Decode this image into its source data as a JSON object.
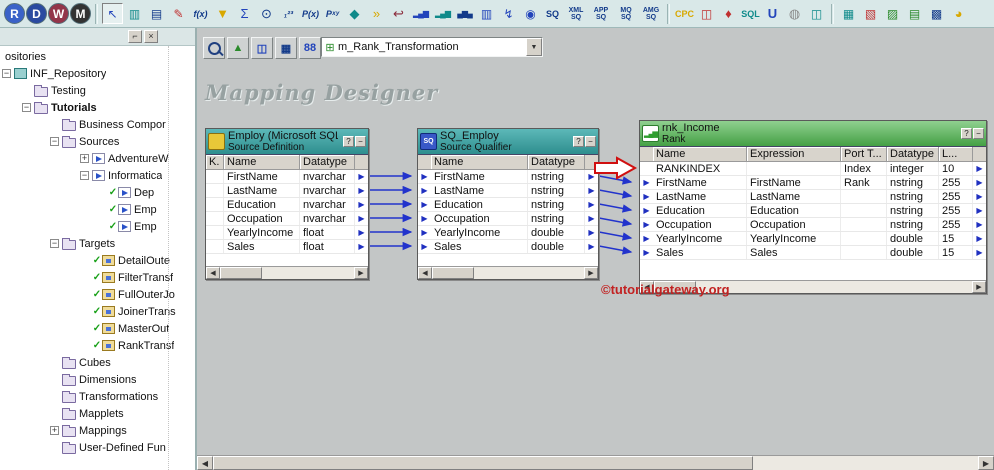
{
  "colors": {
    "toolbar_bg": "#d9e8e8",
    "canvas_bg": "#c3c6c6",
    "source_header_teal": "#3da2a2",
    "rank_header_green": "#55ae55",
    "connection_blue": "#2233cc",
    "credit_red": "#c22222"
  },
  "main_toolbar": {
    "app_buttons": [
      {
        "label": "R"
      },
      {
        "label": "D"
      },
      {
        "label": "W"
      },
      {
        "label": "M"
      }
    ],
    "tools": [
      "↖",
      "▥",
      "▤",
      "✎",
      "f(x)",
      "▼",
      "Σ",
      "⊙",
      "₁²³",
      "P(x)",
      "Pˣʸ",
      "◆",
      "»",
      "↩",
      "▂▄▆",
      "▂▄▆",
      "▄▆▄",
      "▥",
      "↯",
      "◉",
      "SQ",
      "XML SQ",
      "APP SQ",
      "MQ SQ",
      "AMG SQ",
      "CPC",
      "◫",
      "♦",
      "SQL",
      "U",
      "◍",
      "◫",
      "▦",
      "▧",
      "▨",
      "▤",
      "▩",
      "◕"
    ]
  },
  "sidebar": {
    "controls": {
      "dock": "⌐",
      "close": "×"
    },
    "items": [
      {
        "label": "ositories"
      },
      {
        "label": "INF_Repository"
      },
      {
        "label": "Testing"
      },
      {
        "label": "Tutorials"
      },
      {
        "label": "Business Compor"
      },
      {
        "label": "Sources"
      },
      {
        "label": "AdventureW"
      },
      {
        "label": "Informatica"
      },
      {
        "label": "Dep"
      },
      {
        "label": "Emp"
      },
      {
        "label": "Emp"
      },
      {
        "label": "Targets"
      },
      {
        "label": "DetailOute"
      },
      {
        "label": "FilterTransf"
      },
      {
        "label": "FullOuterJo"
      },
      {
        "label": "JoinerTrans"
      },
      {
        "label": "MasterOut"
      },
      {
        "label": "RankTransf"
      },
      {
        "label": "Cubes"
      },
      {
        "label": "Dimensions"
      },
      {
        "label": "Transformations"
      },
      {
        "label": "Mapplets"
      },
      {
        "label": "Mappings"
      },
      {
        "label": "User-Defined Fun"
      }
    ]
  },
  "canvas": {
    "watermark": "Mapping Designer",
    "credit": "©tutorialgateway.org",
    "toolbar": {
      "icons": [
        "",
        "▲",
        "◫",
        "▦",
        "88"
      ],
      "selector_icon": "⊞",
      "selector_value": "m_Rank_Transformation",
      "dropdown_arrow": "▼"
    },
    "box_controls": {
      "help": "?",
      "minimize": "−"
    },
    "boxes": [
      {
        "title": "Employ (Microsoft SQL...",
        "subtitle": "Source Definition",
        "columns": [
          "K.",
          "Name",
          "Datatype"
        ],
        "rows": [
          {
            "key": "",
            "name": "FirstName",
            "datatype": "nvarchar"
          },
          {
            "key": "",
            "name": "LastName",
            "datatype": "nvarchar"
          },
          {
            "key": "",
            "name": "Education",
            "datatype": "nvarchar"
          },
          {
            "key": "",
            "name": "Occupation",
            "datatype": "nvarchar"
          },
          {
            "key": "",
            "name": "YearlyIncome",
            "datatype": "float"
          },
          {
            "key": "",
            "name": "Sales",
            "datatype": "float"
          }
        ]
      },
      {
        "title": "SQ_Employ",
        "subtitle": "Source Qualifier",
        "icon_label": "SQ",
        "columns": [
          "Name",
          "Datatype"
        ],
        "rows": [
          {
            "name": "FirstName",
            "datatype": "nstring"
          },
          {
            "name": "LastName",
            "datatype": "nstring"
          },
          {
            "name": "Education",
            "datatype": "nstring"
          },
          {
            "name": "Occupation",
            "datatype": "nstring"
          },
          {
            "name": "YearlyIncome",
            "datatype": "double"
          },
          {
            "name": "Sales",
            "datatype": "double"
          }
        ]
      },
      {
        "title": "rnk_Income",
        "subtitle": "Rank",
        "icon_label": "▂▄▆",
        "columns": [
          "Name",
          "Expression",
          "Port T...",
          "Datatype",
          "L..."
        ],
        "rows": [
          {
            "name": "RANKINDEX",
            "expression": "",
            "port_type": "Index",
            "datatype": "integer",
            "length": "10"
          },
          {
            "name": "FirstName",
            "expression": "FirstName",
            "port_type": "Rank",
            "datatype": "nstring",
            "length": "255"
          },
          {
            "name": "LastName",
            "expression": "LastName",
            "port_type": "",
            "datatype": "nstring",
            "length": "255"
          },
          {
            "name": "Education",
            "expression": "Education",
            "port_type": "",
            "datatype": "nstring",
            "length": "255"
          },
          {
            "name": "Occupation",
            "expression": "Occupation",
            "port_type": "",
            "datatype": "nstring",
            "length": "255"
          },
          {
            "name": "YearlyIncome",
            "expression": "YearlyIncome",
            "port_type": "",
            "datatype": "double",
            "length": "15"
          },
          {
            "name": "Sales",
            "expression": "Sales",
            "port_type": "",
            "datatype": "double",
            "length": "15"
          }
        ]
      }
    ]
  }
}
